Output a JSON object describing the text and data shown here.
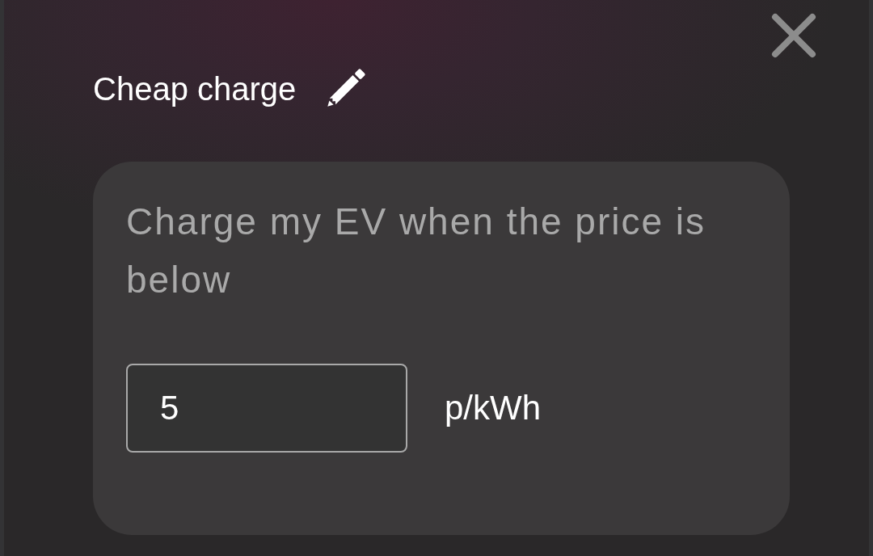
{
  "dialog": {
    "title": "Cheap charge",
    "rule": {
      "prompt": "Charge my EV when the price is below",
      "threshold": {
        "value": "5"
      },
      "unit": "p/kWh"
    }
  }
}
